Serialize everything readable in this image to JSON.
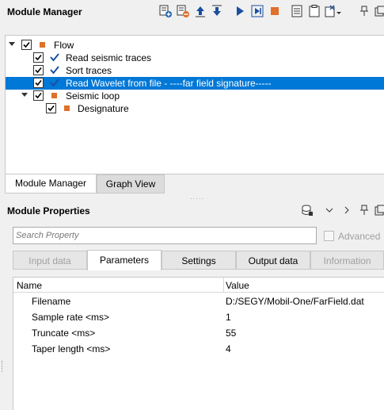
{
  "module_manager": {
    "title": "Module Manager",
    "tree": [
      {
        "label": "Flow",
        "checked": true,
        "kind": "group",
        "expanded": true
      },
      {
        "label": "Read seismic traces",
        "checked": true,
        "kind": "done"
      },
      {
        "label": "Sort traces",
        "checked": true,
        "kind": "done"
      },
      {
        "label": "Read Wavelet from file - ----far field signature-----",
        "checked": true,
        "kind": "done",
        "selected": true
      },
      {
        "label": "Seismic loop",
        "checked": true,
        "kind": "group",
        "expanded": true
      },
      {
        "label": "Designature",
        "checked": true,
        "kind": "module"
      }
    ],
    "tabs": [
      "Module Manager",
      "Graph View"
    ],
    "active_tab": "Module Manager"
  },
  "module_properties": {
    "title": "Module Properties",
    "search_placeholder": "Search Property",
    "advanced_label": "Advanced",
    "tabs": [
      "Input data",
      "Parameters",
      "Settings",
      "Output data",
      "Information"
    ],
    "active_tab": "Parameters",
    "columns": [
      "Name",
      "Value"
    ],
    "rows": [
      {
        "name": "Filename",
        "value": "D:/SEGY/Mobil-One/FarField.dat"
      },
      {
        "name": "Sample rate <ms>",
        "value": "1"
      },
      {
        "name": "Truncate <ms>",
        "value": "55"
      },
      {
        "name": "Taper length <ms>",
        "value": "4"
      }
    ]
  },
  "colors": {
    "selection": "#0078d7",
    "module_square": "#e0702a",
    "accent": "#1a4fa0"
  }
}
